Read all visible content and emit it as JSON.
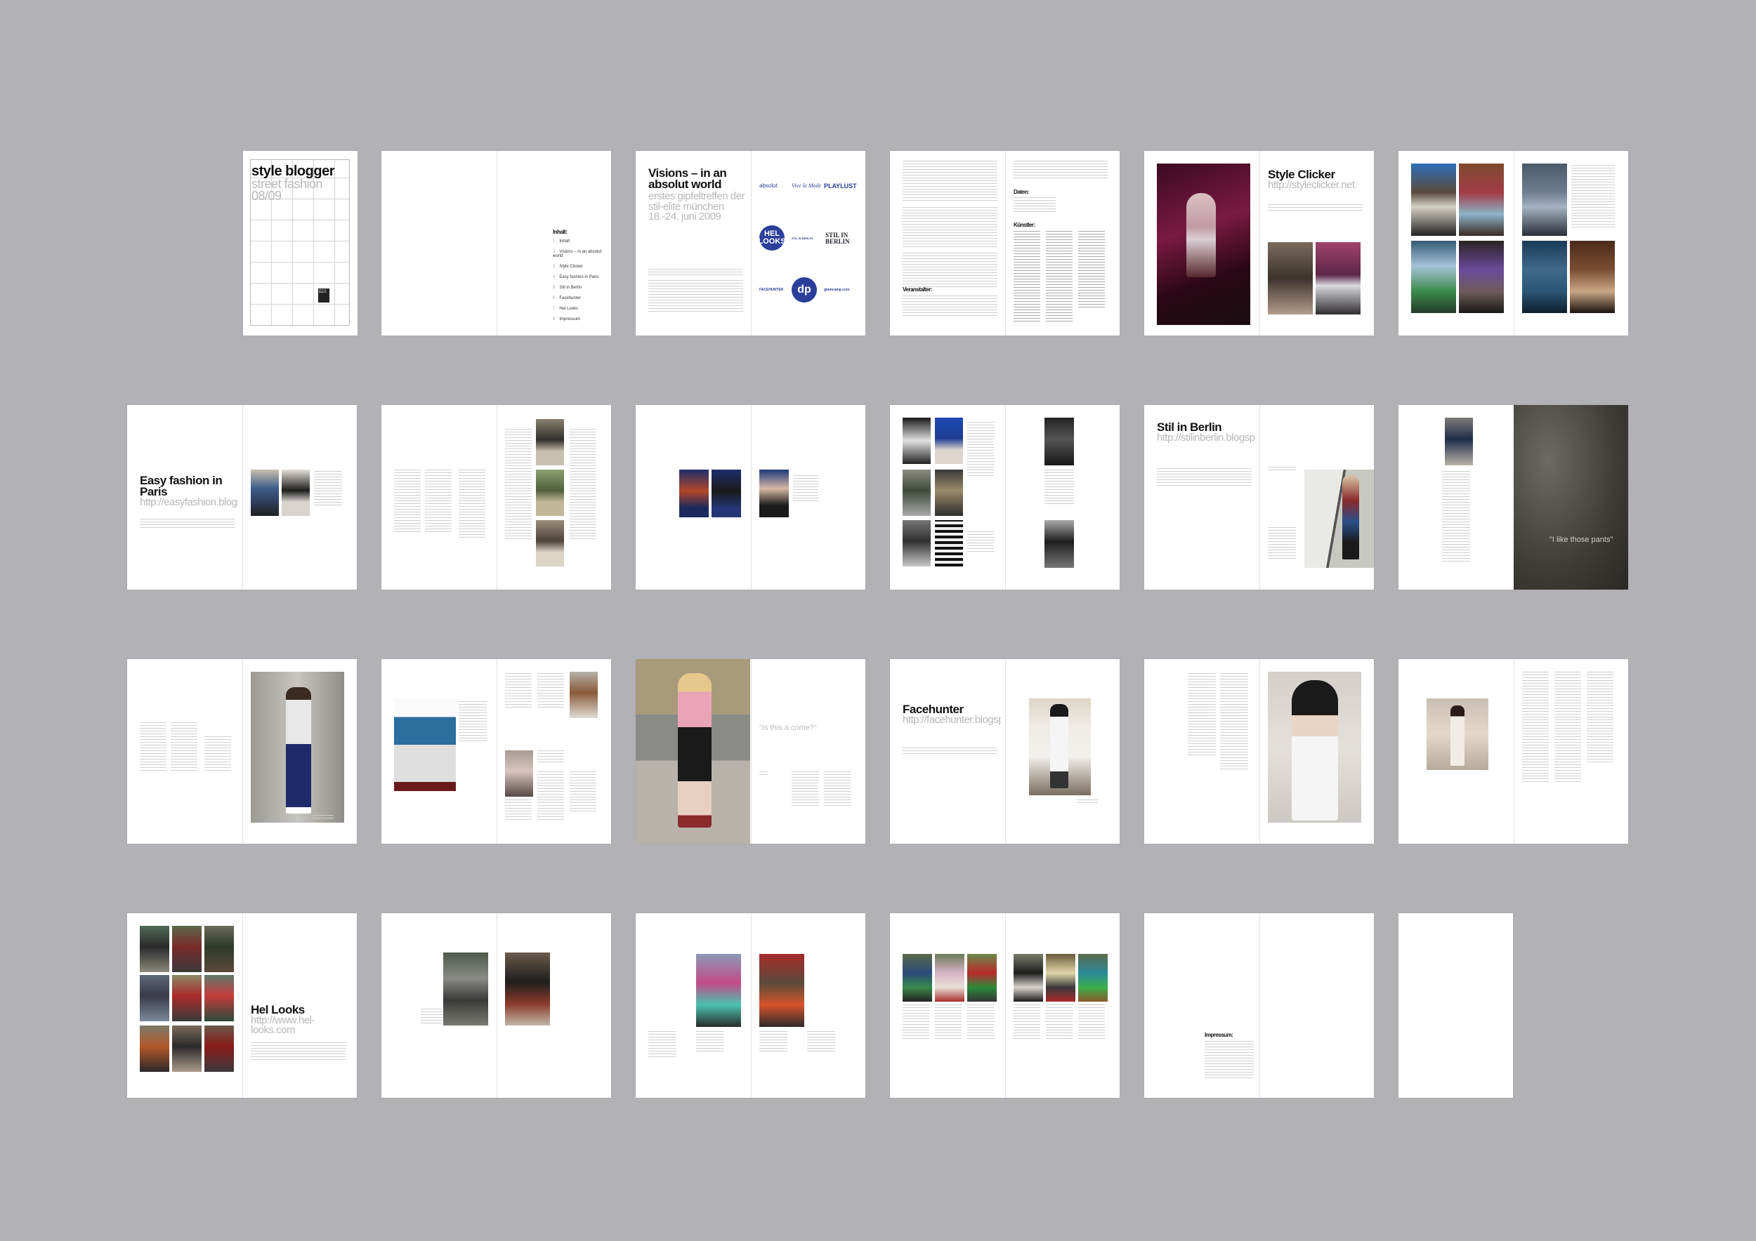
{
  "document": {
    "title": "style blogger",
    "subtitle": "street fashion",
    "year": "08/09"
  },
  "cover": {
    "logo_text": "STIL IN BERLIN"
  },
  "toc": {
    "heading": "Inhalt:",
    "items": [
      "Inhalt",
      "Visions – in an absolut world",
      "Style Clicker",
      "Easy fashion in Paris",
      "Stil in Berlin",
      "Facehunter",
      "Hel Looks",
      "Impressum"
    ]
  },
  "visions": {
    "title": "Visions – in an absolut world",
    "subtitle": "erstes gipfeltreffen der stil-elite münchen 18.-24. juni 2009",
    "logos": [
      "absolut",
      "Vive la Mode",
      "PLAYLUST",
      "HEL LOOKS",
      "STIL IN BERLIN",
      "FACEHUNTER",
      "glamcamp.com",
      "dp"
    ]
  },
  "info": {
    "daten": "Daten:",
    "kuenstler": "Künstler:",
    "veranstalter": "Veranstalter:"
  },
  "style_clicker": {
    "title": "Style Clicker",
    "url": "http://styleclicker.net"
  },
  "easy_fashion": {
    "title": "Easy fashion in Paris",
    "url": "http://easyfashion.blogspot.com"
  },
  "stil_berlin": {
    "title": "Stil in Berlin",
    "url": "http://stilinberlin.blogspot.com"
  },
  "quotes": {
    "pants": "\"I like those pants\"",
    "crime": "\"Is this a crime?\""
  },
  "facehunter": {
    "title": "Facehunter",
    "url": "http://facehunter.blogspot.com"
  },
  "hel_looks": {
    "title": "Hel Looks",
    "url": "http://www.hel-looks.com"
  },
  "impressum": {
    "heading": "Impressum:"
  },
  "colors": {
    "background": "#b2b1b6",
    "page": "#ffffff",
    "logo_blue": "#2b3f9a"
  }
}
